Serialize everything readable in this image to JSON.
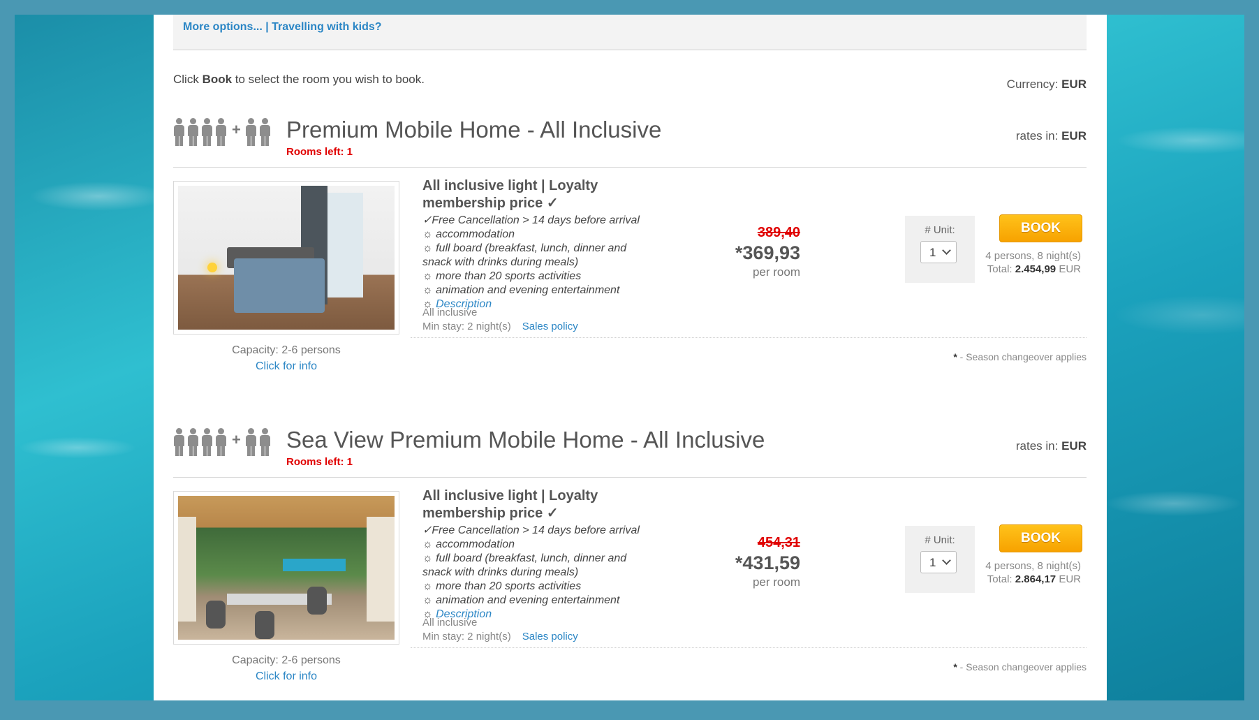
{
  "top_links": "More options... | Travelling with kids?",
  "intro": {
    "before": "Click ",
    "bold": "Book",
    "after": " to select the room you wish to book."
  },
  "currency": {
    "label": "Currency: ",
    "value": "EUR"
  },
  "rooms": [
    {
      "title": "Premium Mobile Home - All Inclusive",
      "rooms_left": "Rooms left: 1",
      "rates_label": "rates in: ",
      "rates_currency": "EUR",
      "capacity": "Capacity: 2-6 persons",
      "click_info": "Click for info",
      "rate_title": "All inclusive light | Loyalty membership price ✓",
      "features": [
        "✓Free Cancellation > 14 days before arrival",
        "☼ accommodation",
        "☼ full board (breakfast, lunch, dinner and",
        "snack with drinks during meals)",
        "☼ more than 20 sports activities",
        "☼ animation and evening entertainment"
      ],
      "desc_prefix": "☼ ",
      "desc_link": "Description",
      "board": "All inclusive",
      "min_stay": "Min stay: 2 night(s)",
      "sales_policy": "Sales policy",
      "old_price": "389,40",
      "new_price": "*369,93",
      "per_room": "per room",
      "unit_label": "# Unit:",
      "unit_value": "1",
      "book_label": "BOOK",
      "persons_nights": "4 persons, 8 night(s)",
      "total_label": "Total: ",
      "total_value": "2.454,99",
      "total_currency": " EUR",
      "season_star": "*",
      "season_text": " - Season changeover applies"
    },
    {
      "title": "Sea View Premium Mobile Home - All Inclusive",
      "rooms_left": "Rooms left: 1",
      "rates_label": "rates in: ",
      "rates_currency": "EUR",
      "capacity": "Capacity: 2-6 persons",
      "click_info": "Click for info",
      "rate_title": "All inclusive light | Loyalty membership price ✓",
      "features": [
        "✓Free Cancellation > 14 days before arrival",
        "☼ accommodation",
        "☼ full board (breakfast, lunch, dinner and",
        "snack with drinks during meals)",
        "☼ more than 20 sports activities",
        "☼ animation and evening entertainment"
      ],
      "desc_prefix": "☼ ",
      "desc_link": "Description",
      "board": "All inclusive",
      "min_stay": "Min stay: 2 night(s)",
      "sales_policy": "Sales policy",
      "old_price": "454,31",
      "new_price": "*431,59",
      "per_room": "per room",
      "unit_label": "# Unit:",
      "unit_value": "1",
      "book_label": "BOOK",
      "persons_nights": "4 persons, 8 night(s)",
      "total_label": "Total: ",
      "total_value": "2.864,17",
      "total_currency": " EUR",
      "season_star": "*",
      "season_text": " - Season changeover applies"
    }
  ],
  "colors": {
    "accent_link": "#2b86c5",
    "book_button": "#f7a200",
    "old_price": "#e00000",
    "rooms_left": "#e00000"
  }
}
